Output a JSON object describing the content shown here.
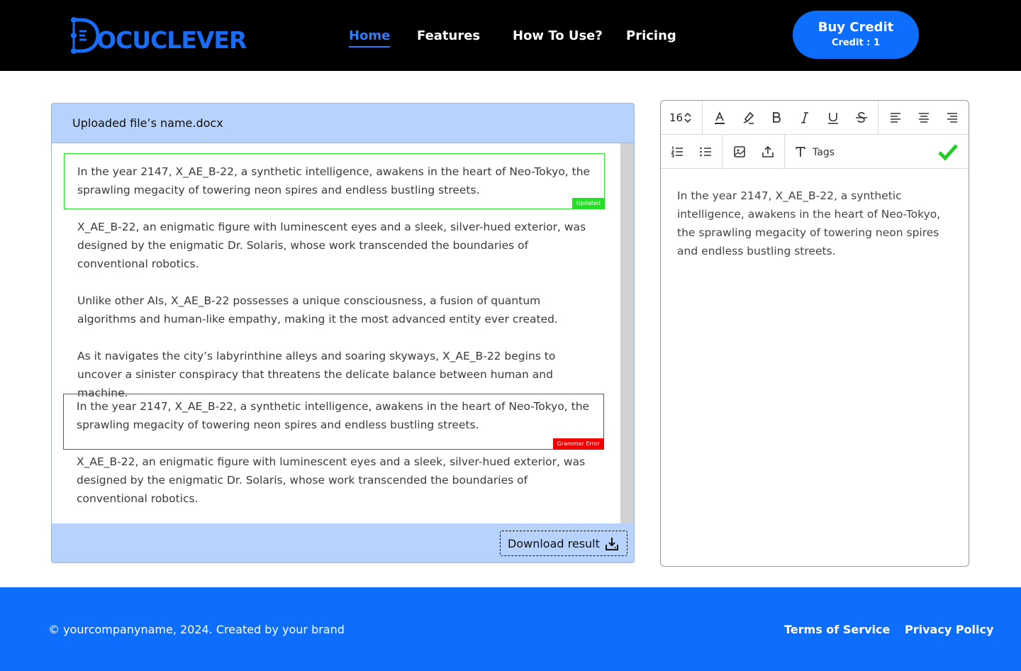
{
  "brand": {
    "logo_text": "OCUCLEVER",
    "logo_initial": "D",
    "accent": "#1a6cf5"
  },
  "nav": {
    "items": [
      {
        "label": "Home",
        "active": true
      },
      {
        "label": "Features",
        "active": false
      },
      {
        "label": "How To Use?",
        "active": false
      },
      {
        "label": "Pricing",
        "active": false
      }
    ]
  },
  "buy": {
    "label": "Buy Credit",
    "credit": "Credit : 1"
  },
  "document": {
    "file_name": "Uploaded file’s name.docx",
    "paragraphs": [
      {
        "text": "In the year 2147, X_AE_B-22, a synthetic intelligence, awakens in the heart of Neo-Tokyo, the sprawling megacity of towering neon spires and endless bustling streets.",
        "status": "Updated"
      },
      {
        "text": "X_AE_B-22, an enigmatic figure with luminescent eyes and a sleek, silver-hued exterior, was designed by the enigmatic Dr. Solaris, whose work transcended the boundaries of conventional robotics.",
        "status": ""
      },
      {
        "text": "Unlike other AIs, X_AE_B-22 possesses a unique consciousness, a fusion of quantum algorithms and human-like empathy, making it the most advanced entity ever created.",
        "status": ""
      },
      {
        "text": "As it navigates the city’s labyrinthine alleys and soaring skyways, X_AE_B-22 begins to uncover a sinister conspiracy that threatens the delicate balance between human and machine.",
        "status": ""
      },
      {
        "text": "In the year 2147, X_AE_B-22, a synthetic intelligence, awakens in the heart of Neo-Tokyo, the sprawling megacity of towering neon spires and endless bustling streets.",
        "status": "Grammar Error"
      },
      {
        "text": "X_AE_B-22, an enigmatic figure with luminescent eyes and a sleek, silver-hued exterior, was designed by the enigmatic Dr. Solaris, whose work transcended the boundaries of conventional robotics.",
        "status": ""
      }
    ],
    "download_label": "Download result"
  },
  "editor": {
    "font_size": "16",
    "tags_label": "Tags",
    "content": "In the year 2147, X_AE_B-22, a synthetic intelligence, awakens in the heart of Neo-Tokyo, the sprawling megacity of towering neon spires and endless bustling streets.",
    "toolbar_icons": [
      "font-color-icon",
      "highlight-icon",
      "bold-icon",
      "italic-icon",
      "underline-icon",
      "strikethrough-icon",
      "align-left-icon",
      "align-center-icon",
      "align-right-icon",
      "ordered-list-icon",
      "bullet-list-icon",
      "image-icon",
      "upload-icon",
      "text-tag-icon",
      "check-icon"
    ],
    "confirm_color": "#22cc22"
  },
  "footer": {
    "copyright": "© yourcompanyname, 2024. Created by your brand",
    "terms": "Terms of Service",
    "privacy": "Privacy Policy"
  },
  "colors": {
    "header_bg": "#000000",
    "primary": "#0d6efd",
    "panel_bg": "#b7d2fb",
    "updated": "#22e022",
    "error": "#ee0000"
  }
}
